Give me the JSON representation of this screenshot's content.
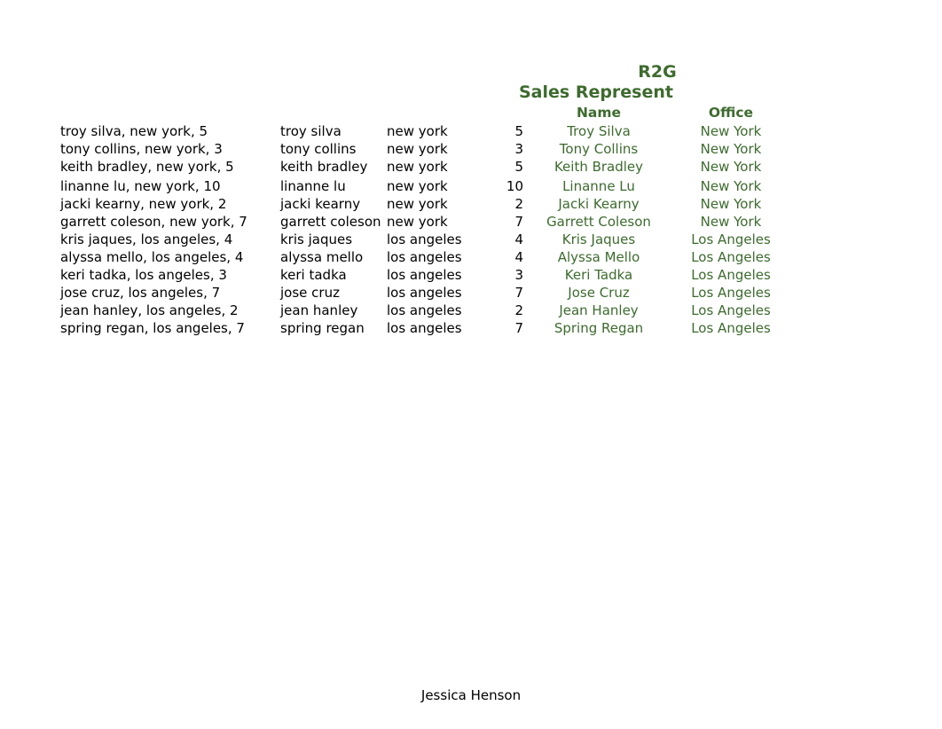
{
  "document": {
    "title_lines": [
      "R2G",
      "Sales Represent"
    ],
    "footer_text": "Jessica Henson",
    "accent_color": "#3d6b2e",
    "text_color": "#000000"
  },
  "table": {
    "headers": {
      "name": "Name",
      "office": "Office"
    },
    "rows": [
      {
        "raw": "troy silva, new york, 5",
        "name": "troy silva",
        "city": "new york",
        "number": "5",
        "proper_name": "Troy Silva",
        "proper_office": "New York"
      },
      {
        "raw": "tony collins, new york, 3",
        "name": "tony collins",
        "city": "new york",
        "number": "3",
        "proper_name": "Tony Collins",
        "proper_office": "New York"
      },
      {
        "raw": "keith bradley, new york, 5",
        "name": "keith bradley",
        "city": "new york",
        "number": "5",
        "proper_name": "Keith Bradley",
        "proper_office": "New York"
      },
      {
        "raw": "linanne lu, new york, 10",
        "name": "linanne lu",
        "city": "new york",
        "number": "10",
        "proper_name": "Linanne Lu",
        "proper_office": "New York"
      },
      {
        "raw": "jacki kearny, new york, 2",
        "name": "jacki kearny",
        "city": "new york",
        "number": "2",
        "proper_name": "Jacki Kearny",
        "proper_office": "New York"
      },
      {
        "raw": "garrett coleson, new york, 7",
        "name": "garrett coleson",
        "city": "new york",
        "number": "7",
        "proper_name": "Garrett Coleson",
        "proper_office": "New York"
      },
      {
        "raw": "kris jaques, los angeles, 4",
        "name": "kris jaques",
        "city": "los angeles",
        "number": "4",
        "proper_name": "Kris Jaques",
        "proper_office": "Los Angeles"
      },
      {
        "raw": "alyssa mello, los angeles, 4",
        "name": "alyssa mello",
        "city": "los angeles",
        "number": "4",
        "proper_name": "Alyssa Mello",
        "proper_office": "Los Angeles"
      },
      {
        "raw": "keri tadka, los angeles, 3",
        "name": "keri tadka",
        "city": "los angeles",
        "number": "3",
        "proper_name": "Keri Tadka",
        "proper_office": "Los Angeles"
      },
      {
        "raw": "jose cruz, los angeles, 7",
        "name": "jose cruz",
        "city": "los angeles",
        "number": "7",
        "proper_name": "Jose Cruz",
        "proper_office": "Los Angeles"
      },
      {
        "raw": "jean hanley, los angeles, 2",
        "name": "jean hanley",
        "city": "los angeles",
        "number": "2",
        "proper_name": "Jean Hanley",
        "proper_office": "Los Angeles"
      },
      {
        "raw": "spring regan, los angeles, 7",
        "name": "spring regan",
        "city": "los angeles",
        "number": "7",
        "proper_name": "Spring Regan",
        "proper_office": "Los Angeles"
      }
    ]
  }
}
